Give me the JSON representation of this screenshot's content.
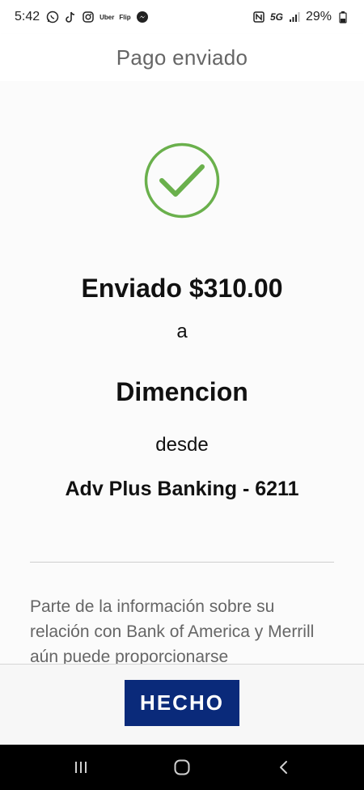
{
  "status_bar": {
    "time": "5:42",
    "notifications": [
      "whatsapp-icon",
      "tiktok-icon",
      "instagram-icon",
      "uber-icon",
      "flip-icon",
      "messenger-icon"
    ],
    "uber_label": "Uber",
    "flip_label": "Flip",
    "network": "5G",
    "battery": "29%"
  },
  "header": {
    "title": "Pago enviado"
  },
  "confirmation": {
    "amount_text": "Enviado $310.00",
    "to_word": "a",
    "payee": "Dimencion",
    "from_word": "desde",
    "account": "Adv Plus Banking - 6211",
    "disclaimer": "Parte de la información sobre su relación con Bank of America y Merrill aún puede proporcionarse"
  },
  "actions": {
    "done_label": "HECHO"
  },
  "colors": {
    "success_green": "#6ab04c",
    "button_navy": "#0a2a7a"
  },
  "nav_bar": {
    "buttons": [
      "recent-apps-icon",
      "home-icon",
      "back-icon"
    ]
  }
}
